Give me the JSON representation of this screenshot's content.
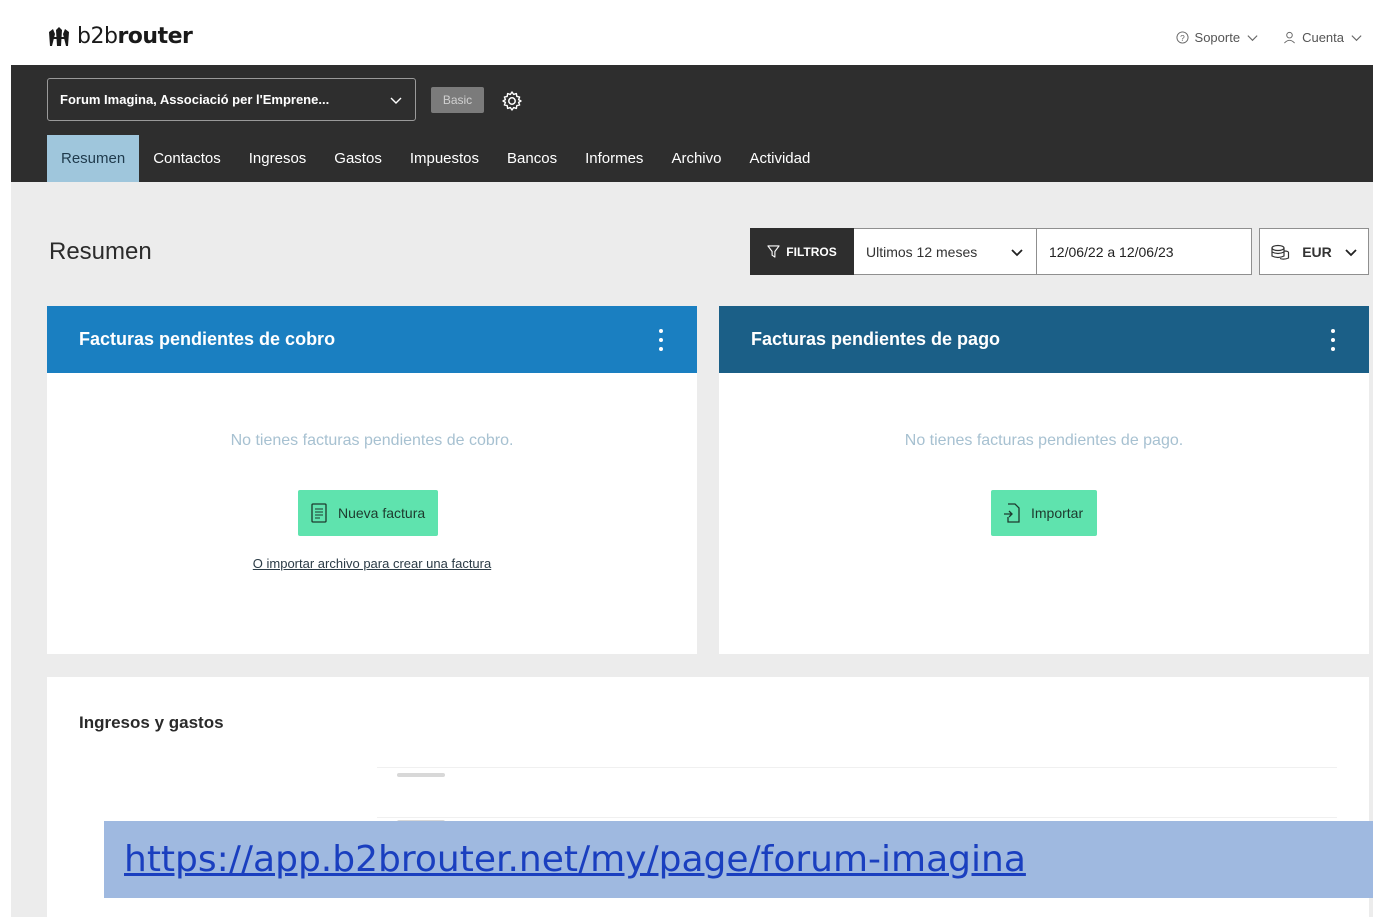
{
  "brand": {
    "prefix": "b2b",
    "name": "router"
  },
  "top_menu": {
    "support": "Soporte",
    "account": "Cuenta"
  },
  "company": {
    "name": "Forum Imagina, Associació per l'Emprene...",
    "plan": "Basic"
  },
  "tabs": [
    {
      "label": "Resumen",
      "active": true
    },
    {
      "label": "Contactos"
    },
    {
      "label": "Ingresos"
    },
    {
      "label": "Gastos"
    },
    {
      "label": "Impuestos"
    },
    {
      "label": "Bancos"
    },
    {
      "label": "Informes"
    },
    {
      "label": "Archivo"
    },
    {
      "label": "Actividad"
    }
  ],
  "page": {
    "title": "Resumen"
  },
  "filters": {
    "button": "FILTROS",
    "period": "Ultimos 12 meses",
    "date_range": "12/06/22 a 12/06/23",
    "currency": "EUR"
  },
  "cards": {
    "receivable": {
      "title": "Facturas pendientes de cobro",
      "empty": "No tienes facturas pendientes de cobro.",
      "button": "Nueva factura",
      "link": "O importar archivo para crear una factura",
      "color": "#1a7fc1"
    },
    "payable": {
      "title": "Facturas pendientes de pago",
      "empty": "No tienes facturas pendientes de pago.",
      "button": "Importar",
      "color": "#1b5f87"
    },
    "income_expenses": {
      "title": "Ingresos y gastos"
    }
  },
  "banner": {
    "url": "https://app.b2brouter.net/my/page/forum-imagina"
  }
}
